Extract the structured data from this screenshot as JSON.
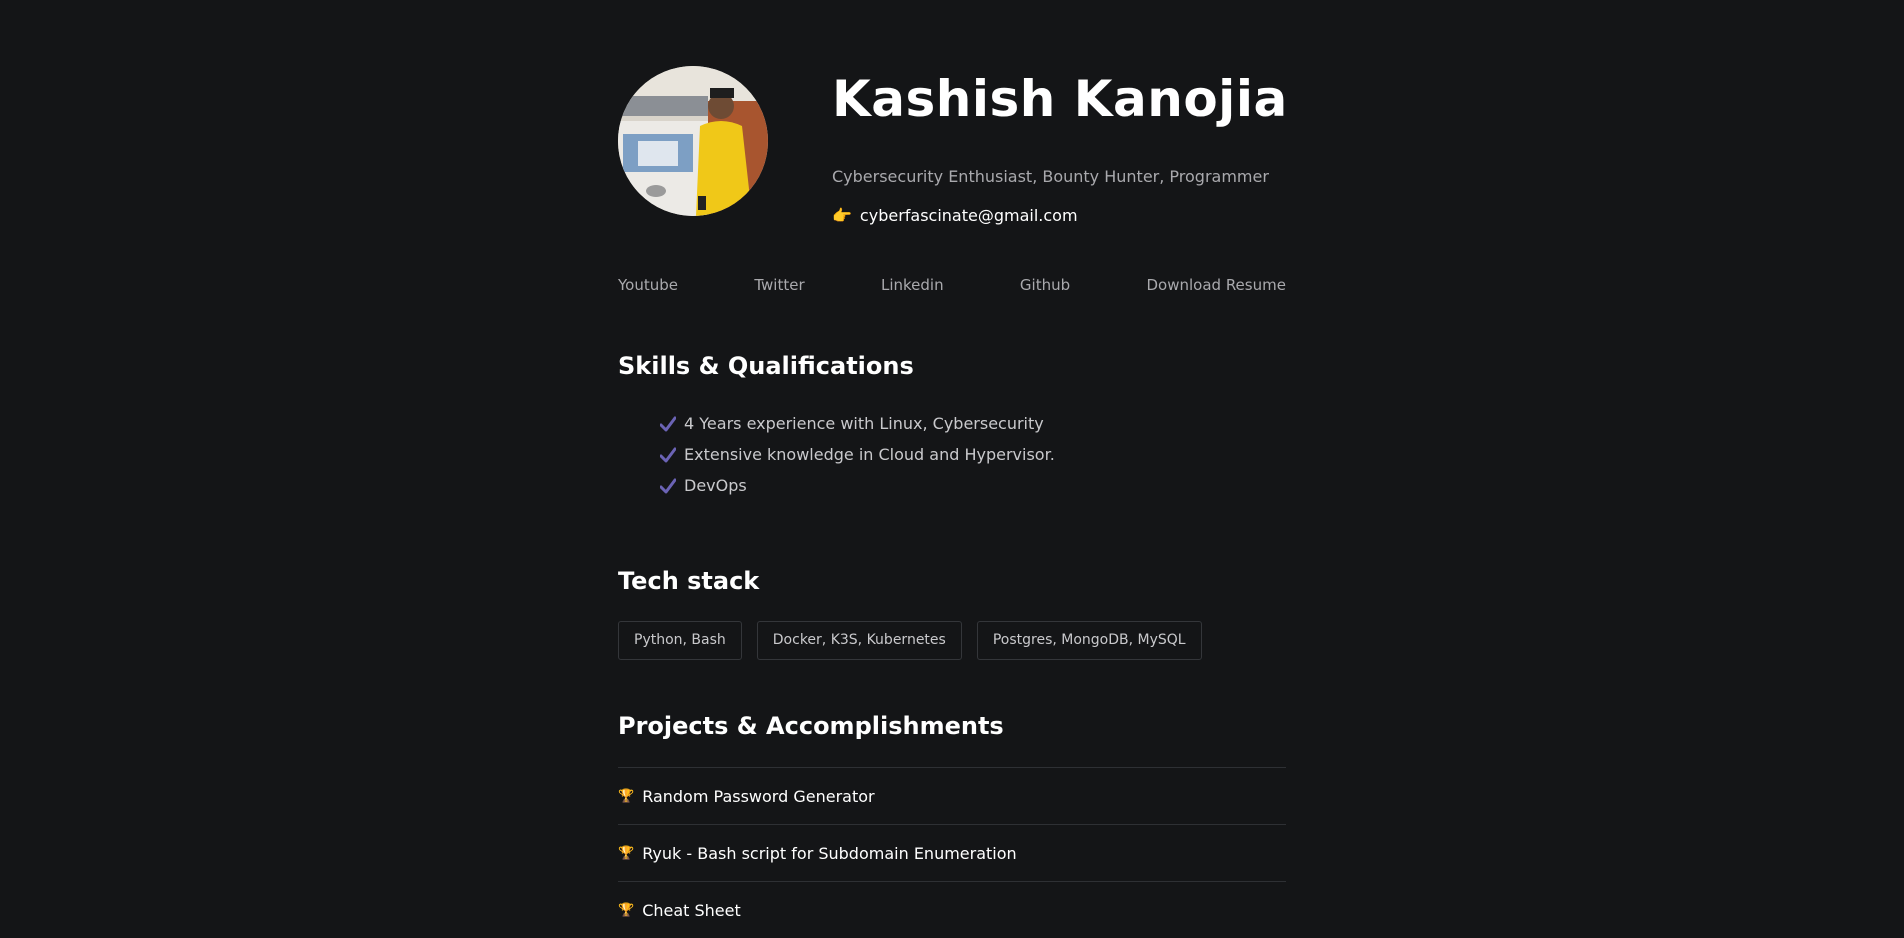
{
  "profile": {
    "name": "Kashish Kanojia",
    "tagline": "Cybersecurity Enthusiast, Bounty Hunter, Programmer",
    "email_emoji": "👉",
    "email": "cyberfascinate@gmail.com",
    "avatar_icon": "profile-photo"
  },
  "nav": {
    "links": [
      {
        "label": "Youtube"
      },
      {
        "label": "Twitter"
      },
      {
        "label": "Linkedin"
      },
      {
        "label": "Github"
      },
      {
        "label": "Download Resume"
      }
    ]
  },
  "skills": {
    "title": "Skills & Qualifications",
    "check_icon": "check-icon",
    "check_color": "#6b63b5",
    "items": [
      "4 Years experience with Linux, Cybersecurity",
      "Extensive knowledge in Cloud and Hypervisor.",
      "DevOps"
    ]
  },
  "tech": {
    "title": "Tech stack",
    "tags": [
      "Python, Bash",
      "Docker, K3S, Kubernetes",
      "Postgres, MongoDB, MySQL"
    ]
  },
  "projects": {
    "title": "Projects & Accomplishments",
    "icon": "trophy-icon",
    "items": [
      {
        "label": "Random Password Generator"
      },
      {
        "label": "Ryuk - Bash script for Subdomain Enumeration"
      },
      {
        "label": "Cheat Sheet"
      }
    ]
  },
  "colors": {
    "background": "#141517",
    "text": "#c9c9cc",
    "heading": "#ffffff"
  }
}
